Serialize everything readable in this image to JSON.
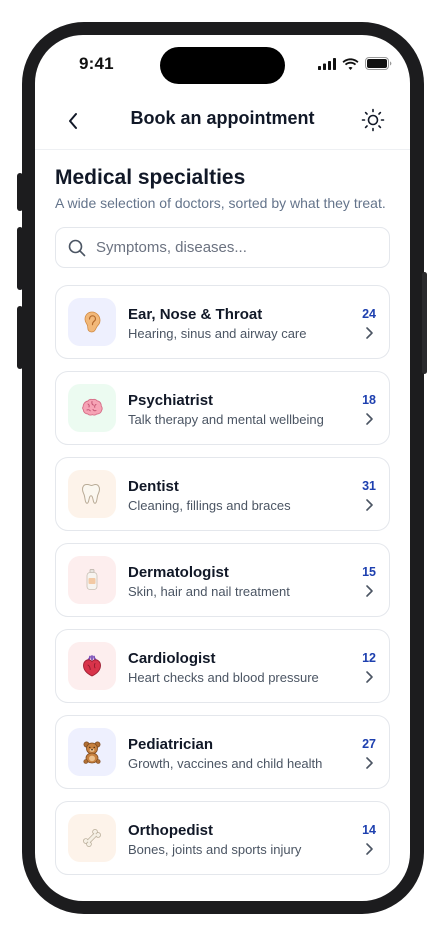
{
  "status_bar": {
    "time": "9:41",
    "icons": [
      "cellular-signal-icon",
      "wifi-icon",
      "battery-icon"
    ]
  },
  "nav": {
    "back_icon": "chevron-left-icon",
    "title": "Book an appointment",
    "theme_icon": "sun-icon"
  },
  "section": {
    "title": "Medical specialties",
    "subtitle": "A wide selection of doctors, sorted by what they treat."
  },
  "search": {
    "icon": "search-icon",
    "placeholder": "Symptoms, diseases...",
    "value": ""
  },
  "colors": {
    "accent": "#1e40af",
    "text_primary": "#111827",
    "text_secondary": "#4b5563",
    "border": "#e4e7ec"
  },
  "specialties": [
    {
      "name": "Ear, Nose & Throat",
      "description": "Hearing, sinus and airway care",
      "count": "24",
      "icon": "ear-icon",
      "icon_bg": "#eef0fe"
    },
    {
      "name": "Psychiatrist",
      "description": "Talk therapy and mental wellbeing",
      "count": "18",
      "icon": "brain-icon",
      "icon_bg": "#ecfbf1"
    },
    {
      "name": "Dentist",
      "description": "Cleaning, fillings and braces",
      "count": "31",
      "icon": "tooth-icon",
      "icon_bg": "#fdf3ea"
    },
    {
      "name": "Dermatologist",
      "description": "Skin, hair and nail treatment",
      "count": "15",
      "icon": "lotion-bottle-icon",
      "icon_bg": "#fdeeee"
    },
    {
      "name": "Cardiologist",
      "description": "Heart checks and blood pressure",
      "count": "12",
      "icon": "anatomical-heart-icon",
      "icon_bg": "#fdeeee"
    },
    {
      "name": "Pediatrician",
      "description": "Growth, vaccines and child health",
      "count": "27",
      "icon": "teddy-bear-icon",
      "icon_bg": "#eef0fe"
    },
    {
      "name": "Orthopedist",
      "description": "Bones, joints and sports injury",
      "count": "14",
      "icon": "bone-icon",
      "icon_bg": "#fdf3ea"
    }
  ]
}
